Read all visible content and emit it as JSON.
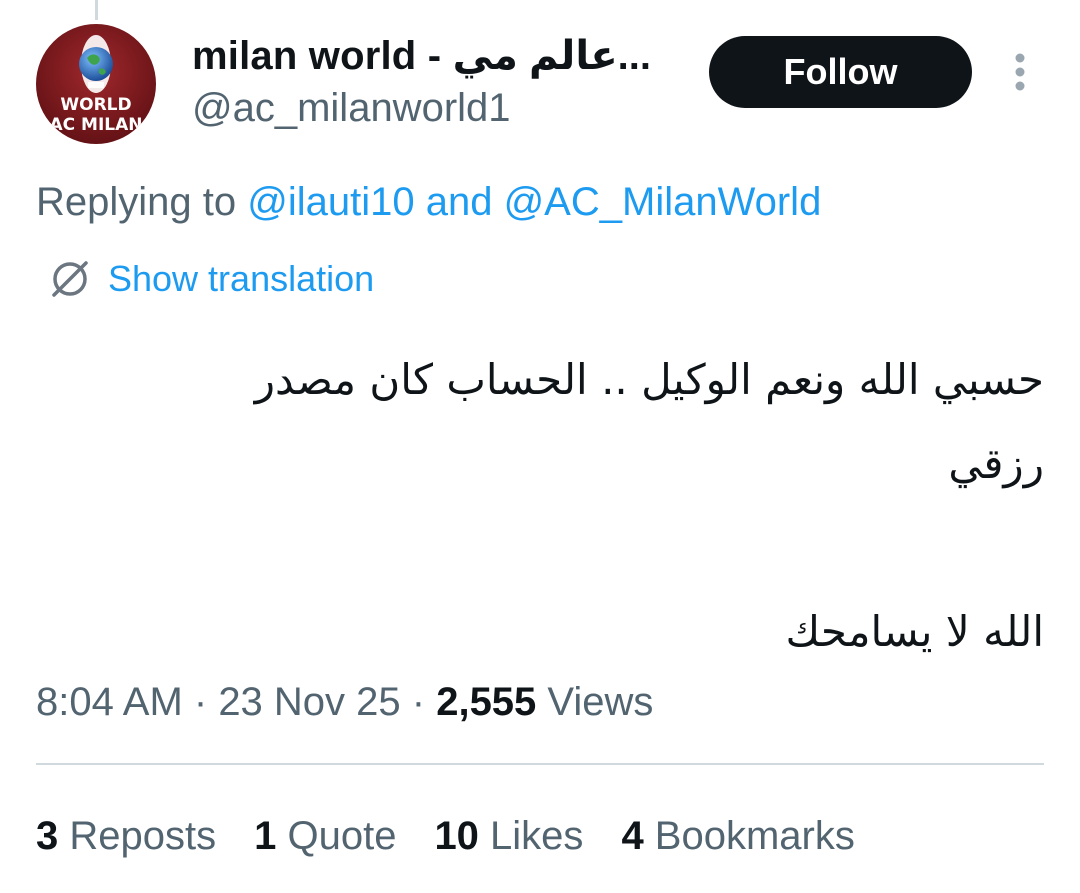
{
  "author": {
    "display_name": "milan world - عالم مي...",
    "handle": "@ac_milanworld1",
    "avatar_text_line1": "WORLD",
    "avatar_text_line2": "AC MILAN"
  },
  "follow_label": "Follow",
  "more_icon": "more-vertical-icon",
  "reply": {
    "prefix": "Replying to ",
    "mention1": "@ilauti10",
    "connector": " and ",
    "mention2": "@AC_MilanWorld"
  },
  "translation": {
    "icon": "globe-slash-icon",
    "label": "Show translation"
  },
  "tweet": {
    "line1": "حسبي الله ونعم الوكيل .. الحساب كان مصدر",
    "line2": "رزقي",
    "line3": "الله لا يسامحك"
  },
  "meta": {
    "time": "8:04 AM",
    "sep": " · ",
    "date": "23 Nov 25",
    "views_count": "2,555",
    "views_label": " Views"
  },
  "stats": [
    {
      "count": "3",
      "label": " Reposts"
    },
    {
      "count": "1",
      "label": " Quote"
    },
    {
      "count": "10",
      "label": " Likes"
    },
    {
      "count": "4",
      "label": " Bookmarks"
    }
  ],
  "colors": {
    "accent": "#1d9bf0",
    "text": "#0f1419",
    "secondary": "#536471",
    "avatar_bg": "#7a1419"
  }
}
